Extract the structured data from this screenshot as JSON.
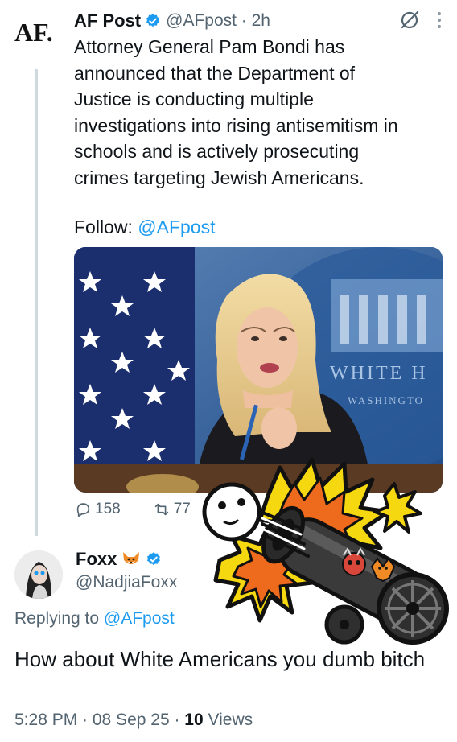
{
  "post": {
    "avatar_text": "AF.",
    "name": "AF Post",
    "handle_time": "@AFpost · 2h",
    "body_lines": [
      "Attorney General Pam Bondi has",
      "announced that the Department of",
      "Justice is conducting multiple",
      "investigations into rising antisemitism in",
      "schools and is actively prosecuting",
      "crimes targeting Jewish Americans."
    ],
    "follow_label": "Follow: ",
    "follow_handle": "@AFpost",
    "image_sign_text": "WHITE H",
    "image_sign_sub": "WASHINGTO",
    "replies": "158",
    "reposts": "77"
  },
  "reply": {
    "name": "Foxx",
    "handle": "@NadjiaFoxx",
    "replying_label": "Replying to ",
    "replying_handle": "@AFpost",
    "text": "How about White Americans you dumb bitch",
    "time_date": "5:28 PM · 08 Sep 25 · ",
    "views_count": "10",
    "views_label": " Views"
  },
  "colors": {
    "accent": "#1d9bf0",
    "secondary_text": "#536471",
    "verified_badge": "#1d9bf0"
  },
  "icons": [
    "verified-badge-icon",
    "grok-slash-icon",
    "more-vertical-icon",
    "reply-icon",
    "repost-icon",
    "fox-emoji-icon",
    "cannon-sticker"
  ]
}
